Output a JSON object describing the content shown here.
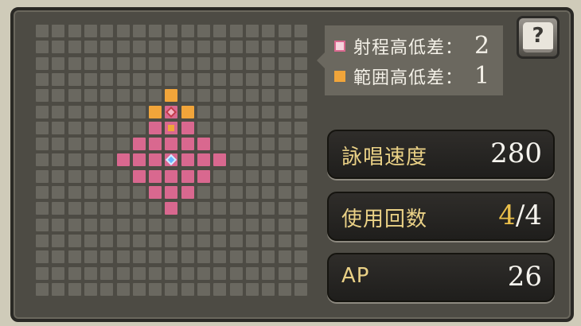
{
  "legend": {
    "rows": [
      {
        "label": "射程高低差：",
        "value": "2",
        "swatch_color": "#d9688f"
      },
      {
        "label": "範囲高低差：",
        "value": "1",
        "swatch_color": "#f1a53a"
      }
    ]
  },
  "help_button": {
    "icon": "help-book-icon",
    "glyph": "?"
  },
  "stats": [
    {
      "label": "詠唱速度",
      "value": "280"
    },
    {
      "label": "使用回数",
      "value_current": "4",
      "value_sep": "/",
      "value_max": "4"
    },
    {
      "label": "AP",
      "value": "26"
    }
  ],
  "colors": {
    "range": "#d9688f",
    "area": "#f1a53a",
    "grid_cell": "#6a6860",
    "stat_label": "#ead186",
    "uses_highlight": "#eabf4a"
  },
  "range_grid": {
    "columns": 17,
    "rows": 17,
    "caster_marker": "caster-diamond-icon",
    "target_marker": "target-diamond-icon",
    "range_cells": [
      [
        8,
        5
      ],
      [
        7,
        6
      ],
      [
        8,
        6
      ],
      [
        9,
        6
      ],
      [
        6,
        7
      ],
      [
        7,
        7
      ],
      [
        8,
        7
      ],
      [
        9,
        7
      ],
      [
        10,
        7
      ],
      [
        5,
        8
      ],
      [
        6,
        8
      ],
      [
        7,
        8
      ],
      [
        8,
        8
      ],
      [
        9,
        8
      ],
      [
        10,
        8
      ],
      [
        11,
        8
      ],
      [
        6,
        9
      ],
      [
        7,
        9
      ],
      [
        8,
        9
      ],
      [
        9,
        9
      ],
      [
        10,
        9
      ],
      [
        7,
        10
      ],
      [
        8,
        10
      ],
      [
        9,
        10
      ],
      [
        8,
        11
      ]
    ],
    "area_cells": [
      [
        8,
        4
      ],
      [
        7,
        5
      ],
      [
        9,
        5
      ],
      [
        8,
        6
      ]
    ],
    "caster_cell": [
      8,
      8
    ],
    "target_cell": [
      8,
      5
    ]
  }
}
